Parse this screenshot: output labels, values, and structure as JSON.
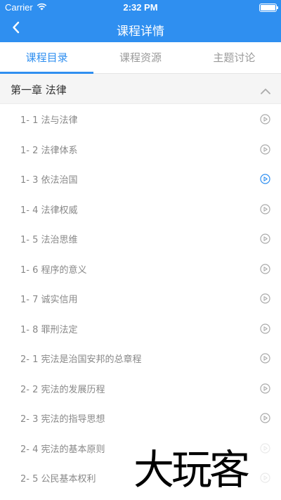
{
  "status_bar": {
    "carrier": "Carrier",
    "time": "2:32 PM",
    "battery_level": 1.0
  },
  "nav": {
    "title": "课程详情",
    "back_icon": "chevron-left-icon"
  },
  "colors": {
    "primary": "#2f8ff0",
    "muted_text": "#888888",
    "chapter_bg": "#f5f5f5"
  },
  "tabs": [
    {
      "label": "课程目录",
      "active": true
    },
    {
      "label": "课程资源",
      "active": false
    },
    {
      "label": "主题讨论",
      "active": false
    }
  ],
  "chapter": {
    "title": "第一章 法律",
    "expanded": true
  },
  "lessons": [
    {
      "label": "1- 1 法与法律",
      "active": false
    },
    {
      "label": "1- 2 法律体系",
      "active": false
    },
    {
      "label": "1- 3 依法治国",
      "active": true
    },
    {
      "label": "1- 4 法律权威",
      "active": false
    },
    {
      "label": "1- 5 法治思维",
      "active": false
    },
    {
      "label": "1- 6 程序的意义",
      "active": false
    },
    {
      "label": "1- 7 诚实信用",
      "active": false
    },
    {
      "label": "1- 8 罪刑法定",
      "active": false
    },
    {
      "label": "2- 1 宪法是治国安邦的总章程",
      "active": false
    },
    {
      "label": "2- 2 宪法的发展历程",
      "active": false
    },
    {
      "label": "2- 3 宪法的指导思想",
      "active": false
    },
    {
      "label": "2- 4 宪法的基本原则",
      "active": false
    },
    {
      "label": "2- 5 公民基本权利",
      "active": false
    }
  ],
  "watermark": "大玩客"
}
